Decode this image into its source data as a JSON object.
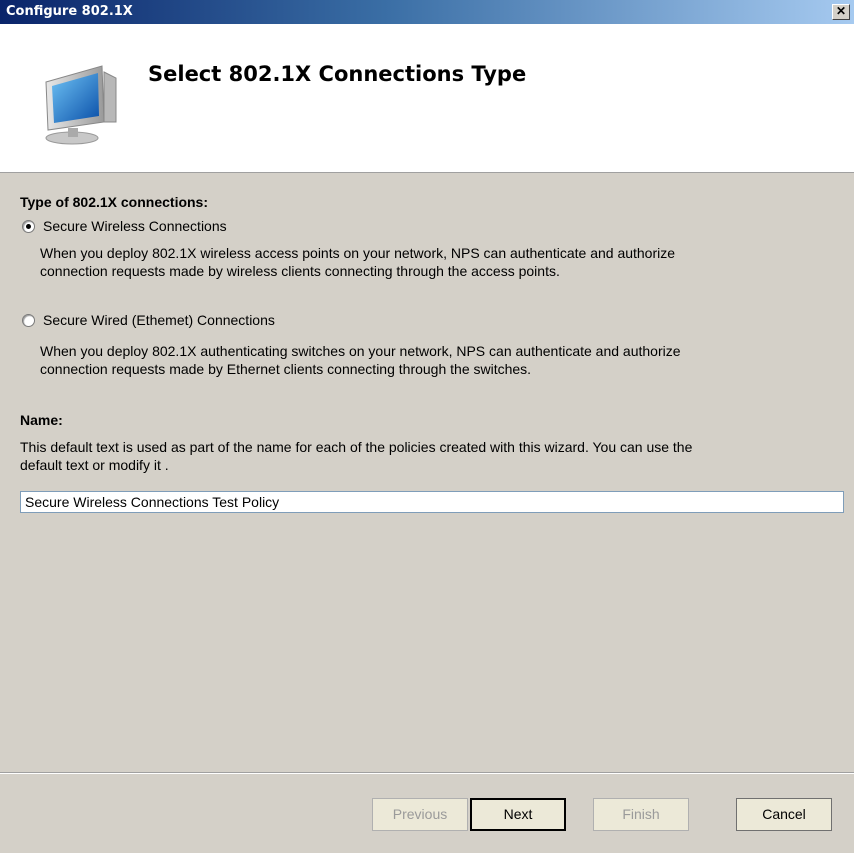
{
  "window": {
    "title": "Configure 802.1X",
    "close_label": "✕"
  },
  "header": {
    "title": "Select 802.1X Connections Type",
    "icon": "computer-monitor-icon"
  },
  "connections": {
    "section_label": "Type of 802.1X connections:",
    "options": [
      {
        "label": "Secure Wireless Connections",
        "selected": true,
        "description_line1": "When you deploy 802.1X wireless access points on your network, NPS can authenticate and authorize",
        "description_line2": "connection requests made by wireless clients connecting through the access points."
      },
      {
        "label": "Secure Wired (Ethemet) Connections",
        "selected": false,
        "description_line1": "When you deploy 802.1X authenticating switches on your network, NPS can authenticate and authorize",
        "description_line2": "connection requests made by Ethernet clients connecting through the switches."
      }
    ]
  },
  "name": {
    "section_label": "Name:",
    "description_line1": "This default text is used as part of the name for each of the policies created with this wizard. You can use the",
    "description_line2": "default text or modify it .",
    "value": "Secure Wireless Connections Test Policy"
  },
  "buttons": {
    "previous": "Previous",
    "next": "Next",
    "finish": "Finish",
    "cancel": "Cancel"
  }
}
